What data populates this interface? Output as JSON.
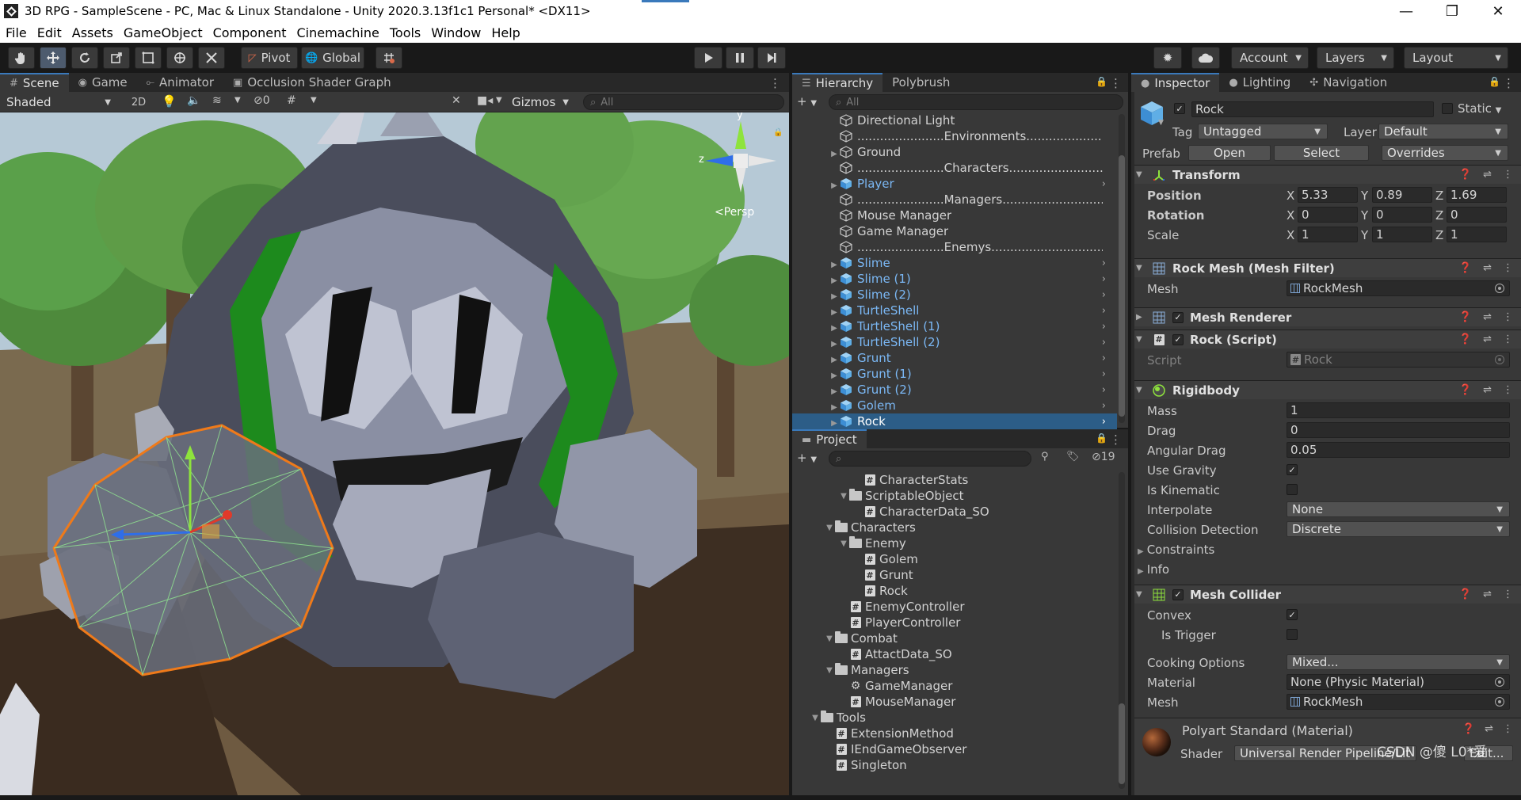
{
  "window": {
    "title": "3D RPG - SampleScene - PC, Mac & Linux Standalone - Unity 2020.3.13f1c1 Personal* <DX11>",
    "controls": [
      "—",
      "❐",
      "✕"
    ]
  },
  "menu": [
    "File",
    "Edit",
    "Assets",
    "GameObject",
    "Component",
    "Cinemachine",
    "Tools",
    "Window",
    "Help"
  ],
  "toolbar": {
    "pivot": "Pivot",
    "global": "Global",
    "account": "Account",
    "layers": "Layers",
    "layout": "Layout"
  },
  "scene_panel": {
    "tabs": [
      "Scene",
      "Game",
      "Animator",
      "Occlusion Shader Graph"
    ],
    "shading_mode": "Shaded",
    "mode_2d": "2D",
    "hidden_count": "0",
    "gizmos": "Gizmos",
    "search_placeholder": "All",
    "gizmo_y": "y",
    "gizmo_z": "z",
    "projection": "Persp"
  },
  "hierarchy": {
    "tabs": [
      "Hierarchy",
      "Polybrush"
    ],
    "search_placeholder": "All",
    "items": [
      {
        "label": "Directional Light",
        "type": "object",
        "expand": false
      },
      {
        "label": ".......................Environments..............................",
        "type": "object",
        "expand": false
      },
      {
        "label": "Ground",
        "type": "object",
        "expand": true
      },
      {
        "label": ".......................Characters..............................",
        "type": "object",
        "expand": false
      },
      {
        "label": "Player",
        "type": "prefab",
        "expand": true
      },
      {
        "label": ".......................Managers...............................",
        "type": "object",
        "expand": false
      },
      {
        "label": "Mouse Manager",
        "type": "object",
        "expand": false
      },
      {
        "label": "Game Manager",
        "type": "object",
        "expand": false
      },
      {
        "label": ".......................Enemys...............................",
        "type": "object",
        "expand": false
      },
      {
        "label": "Slime",
        "type": "prefab",
        "expand": true
      },
      {
        "label": "Slime (1)",
        "type": "prefab",
        "expand": true
      },
      {
        "label": "Slime (2)",
        "type": "prefab",
        "expand": true
      },
      {
        "label": "TurtleShell",
        "type": "prefab",
        "expand": true
      },
      {
        "label": "TurtleShell (1)",
        "type": "prefab",
        "expand": true
      },
      {
        "label": "TurtleShell (2)",
        "type": "prefab",
        "expand": true
      },
      {
        "label": "Grunt",
        "type": "prefab",
        "expand": true
      },
      {
        "label": "Grunt (1)",
        "type": "prefab",
        "expand": true
      },
      {
        "label": "Grunt (2)",
        "type": "prefab",
        "expand": true
      },
      {
        "label": "Golem",
        "type": "prefab",
        "expand": true
      },
      {
        "label": "Rock",
        "type": "prefab-selected",
        "expand": true
      }
    ]
  },
  "project": {
    "tab": "Project",
    "hidden_count": "19",
    "items": [
      {
        "label": "CharacterStats",
        "kind": "script",
        "indent": 3,
        "arrow": ""
      },
      {
        "label": "ScriptableObject",
        "kind": "folder",
        "indent": 2,
        "arrow": "▼"
      },
      {
        "label": "CharacterData_SO",
        "kind": "script",
        "indent": 3,
        "arrow": ""
      },
      {
        "label": "Characters",
        "kind": "folder",
        "indent": 1,
        "arrow": "▼"
      },
      {
        "label": "Enemy",
        "kind": "folder",
        "indent": 2,
        "arrow": "▼"
      },
      {
        "label": "Golem",
        "kind": "script",
        "indent": 3,
        "arrow": ""
      },
      {
        "label": "Grunt",
        "kind": "script",
        "indent": 3,
        "arrow": ""
      },
      {
        "label": "Rock",
        "kind": "script",
        "indent": 3,
        "arrow": ""
      },
      {
        "label": "EnemyController",
        "kind": "script",
        "indent": 2,
        "arrow": ""
      },
      {
        "label": "PlayerController",
        "kind": "script",
        "indent": 2,
        "arrow": ""
      },
      {
        "label": "Combat",
        "kind": "folder",
        "indent": 1,
        "arrow": "▼"
      },
      {
        "label": "AttactData_SO",
        "kind": "script",
        "indent": 2,
        "arrow": ""
      },
      {
        "label": "Managers",
        "kind": "folder",
        "indent": 1,
        "arrow": "▼"
      },
      {
        "label": "GameManager",
        "kind": "gear",
        "indent": 2,
        "arrow": ""
      },
      {
        "label": "MouseManager",
        "kind": "script",
        "indent": 2,
        "arrow": ""
      },
      {
        "label": "Tools",
        "kind": "folder",
        "indent": 0,
        "arrow": "▼"
      },
      {
        "label": "ExtensionMethod",
        "kind": "script",
        "indent": 1,
        "arrow": ""
      },
      {
        "label": "IEndGameObserver",
        "kind": "script",
        "indent": 1,
        "arrow": ""
      },
      {
        "label": "Singleton",
        "kind": "script",
        "indent": 1,
        "arrow": ""
      }
    ]
  },
  "inspector": {
    "tabs": [
      "Inspector",
      "Lighting",
      "Navigation"
    ],
    "object_name": "Rock",
    "static_label": "Static",
    "tag_label": "Tag",
    "tag_value": "Untagged",
    "layer_label": "Layer",
    "layer_value": "Default",
    "prefab_label": "Prefab",
    "prefab_open": "Open",
    "prefab_select": "Select",
    "prefab_overrides": "Overrides",
    "transform": {
      "title": "Transform",
      "position_label": "Position",
      "rotation_label": "Rotation",
      "scale_label": "Scale",
      "axis_x": "X",
      "axis_y": "Y",
      "axis_z": "Z",
      "position": [
        "5.33",
        "0.89",
        "1.69"
      ],
      "rotation": [
        "0",
        "0",
        "0"
      ],
      "scale": [
        "1",
        "1",
        "1"
      ]
    },
    "mesh_filter": {
      "title": "Rock Mesh (Mesh Filter)",
      "mesh_label": "Mesh",
      "mesh_value": "RockMesh"
    },
    "mesh_renderer": {
      "title": "Mesh Renderer"
    },
    "rock_script": {
      "title": "Rock (Script)",
      "script_label": "Script",
      "script_value": "Rock"
    },
    "rigidbody": {
      "title": "Rigidbody",
      "mass_label": "Mass",
      "mass": "1",
      "drag_label": "Drag",
      "drag": "0",
      "angular_drag_label": "Angular Drag",
      "angular_drag": "0.05",
      "use_gravity_label": "Use Gravity",
      "is_kinematic_label": "Is Kinematic",
      "interpolate_label": "Interpolate",
      "interpolate": "None",
      "collision_label": "Collision Detection",
      "collision": "Discrete",
      "constraints_label": "Constraints",
      "info_label": "Info"
    },
    "mesh_collider": {
      "title": "Mesh Collider",
      "convex_label": "Convex",
      "is_trigger_label": "Is Trigger",
      "cooking_label": "Cooking Options",
      "cooking": "Mixed...",
      "material_label": "Material",
      "material": "None (Physic Material)",
      "mesh_label": "Mesh",
      "mesh": "RockMesh"
    },
    "material": {
      "title": "Polyart Standard (Material)",
      "shader_label": "Shader",
      "shader_value": "Universal Render Pipeline/Lit",
      "edit_label": "Edit..."
    },
    "watermark": "CSDN @傻 L0*爱"
  }
}
